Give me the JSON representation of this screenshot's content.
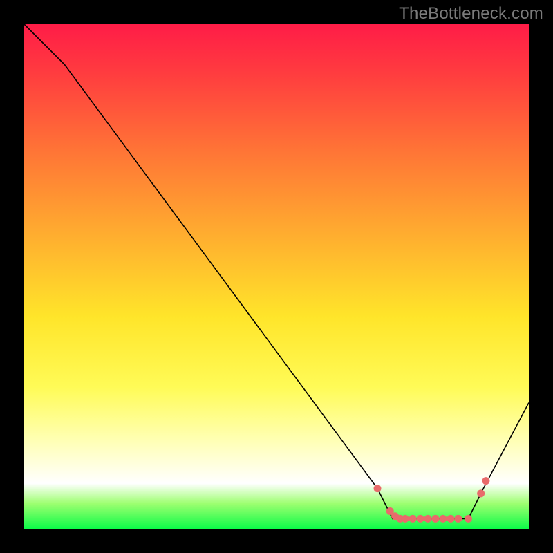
{
  "watermark": "TheBottleneck.com",
  "chart_data": {
    "type": "line",
    "title": "",
    "xlabel": "",
    "ylabel": "",
    "xlim": [
      0,
      100
    ],
    "ylim": [
      0,
      100
    ],
    "series": [
      {
        "name": "bottleneck-curve",
        "x": [
          0,
          8,
          70,
          73,
          88,
          91,
          100
        ],
        "y": [
          100,
          92,
          8,
          2,
          2,
          8,
          25
        ],
        "color": "#000000"
      }
    ],
    "markers": {
      "name": "optimal-range",
      "color": "#e86b6b",
      "x": [
        70,
        72.5,
        73.5,
        74.5,
        75.5,
        77,
        78.5,
        80,
        81.5,
        83,
        84.5,
        86,
        88,
        90.5,
        91.5
      ],
      "y": [
        8,
        3.5,
        2.5,
        2,
        2,
        2,
        2,
        2,
        2,
        2,
        2,
        2,
        2,
        7,
        9.5
      ]
    },
    "gradient_stops": [
      {
        "pos": 0.0,
        "color": "#ff1c47"
      },
      {
        "pos": 0.1,
        "color": "#ff3d3f"
      },
      {
        "pos": 0.25,
        "color": "#ff7436"
      },
      {
        "pos": 0.42,
        "color": "#ffae2f"
      },
      {
        "pos": 0.58,
        "color": "#ffe52a"
      },
      {
        "pos": 0.72,
        "color": "#fffb57"
      },
      {
        "pos": 0.82,
        "color": "#ffffb0"
      },
      {
        "pos": 0.91,
        "color": "#ffffff"
      },
      {
        "pos": 0.95,
        "color": "#9dff70"
      },
      {
        "pos": 1.0,
        "color": "#0dfb48"
      }
    ]
  }
}
